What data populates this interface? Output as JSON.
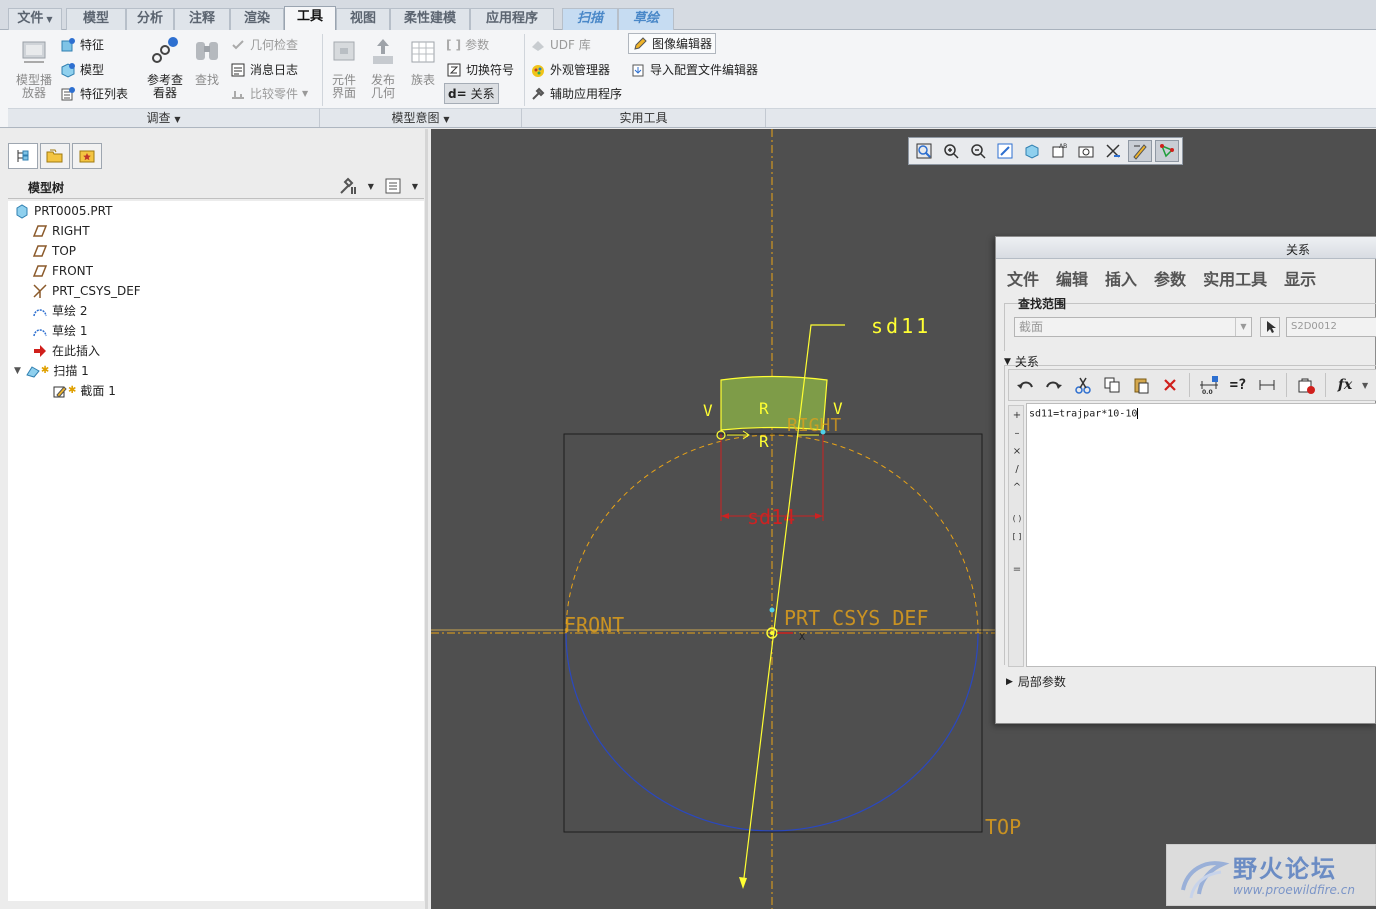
{
  "tabs": [
    {
      "label": "文件",
      "dropdown": true
    },
    {
      "label": "模型"
    },
    {
      "label": "分析"
    },
    {
      "label": "注释"
    },
    {
      "label": "渲染"
    },
    {
      "label": "工具",
      "active": true
    },
    {
      "label": "视图"
    },
    {
      "label": "柔性建模"
    },
    {
      "label": "应用程序"
    },
    {
      "label": "扫描",
      "contextual": true
    },
    {
      "label": "草绘",
      "contextual": true
    }
  ],
  "ribbon": {
    "investigate": {
      "model_player_l1": "模型播",
      "model_player_l2": "放器",
      "feature": "特征",
      "model": "模型",
      "feature_list": "特征列表",
      "ref_viewer_l1": "参考查",
      "ref_viewer_l2": "看器",
      "find": "查找",
      "geom_check": "几何检查",
      "message_log": "消息日志",
      "compare_parts": "比较零件",
      "footer": "调查"
    },
    "model_intent": {
      "component_interface_l1": "元件",
      "component_interface_l2": "界面",
      "publish_geom_l1": "发布",
      "publish_geom_l2": "几何",
      "family_table": "族表",
      "parameters": "参数",
      "switch_symbols": "切换符号",
      "relations": "关系",
      "relations_prefix": "d=",
      "footer": "模型意图"
    },
    "utilities": {
      "udf_library": "UDF 库",
      "appearance_manager": "外观管理器",
      "auxiliary_apps": "辅助应用程序",
      "image_editor": "图像编辑器",
      "import_config_editor": "导入配置文件编辑器",
      "footer": "实用工具"
    }
  },
  "model_tree": {
    "title": "模型树",
    "items": [
      {
        "label": "PRT0005.PRT",
        "icon": "part-icon"
      },
      {
        "label": "RIGHT",
        "icon": "datum-plane-icon"
      },
      {
        "label": "TOP",
        "icon": "datum-plane-icon"
      },
      {
        "label": "FRONT",
        "icon": "datum-plane-icon"
      },
      {
        "label": "PRT_CSYS_DEF",
        "icon": "csys-icon"
      },
      {
        "label": "草绘 2",
        "icon": "sketch-icon"
      },
      {
        "label": "草绘 1",
        "icon": "sketch-icon"
      },
      {
        "label": "在此插入",
        "icon": "insert-arrow-icon"
      },
      {
        "label": "扫描 1",
        "icon": "sweep-icon"
      },
      {
        "label": "截面 1",
        "icon": "section-icon"
      }
    ]
  },
  "viewport": {
    "labels": {
      "sd11": "sd11",
      "sd14": "sd14",
      "front": "FRONT",
      "top": "TOP",
      "right": "RIGHT",
      "csys": "PRT_CSYS_DEF",
      "x": "X",
      "v": "V",
      "r": "R"
    },
    "colors": {
      "background": "#4f4f4f",
      "datum": "#e8a317",
      "sketch": "#ffff33",
      "dimension": "#cc2222",
      "circle": "#2a48c0",
      "section_fill": "#7e9c48"
    }
  },
  "dialog": {
    "title": "关系",
    "menu": [
      "文件",
      "编辑",
      "插入",
      "参数",
      "实用工具",
      "显示"
    ],
    "scope_label": "查找范围",
    "scope_value": "截面",
    "symbol_field": "S2D0012",
    "relations_header": "关系",
    "relation_text": "sd11=trajpar*10-10",
    "local_params": "局部参数",
    "side_keys": [
      "+",
      "–",
      "×",
      "/",
      "^",
      "( )",
      "[ ]",
      "="
    ]
  },
  "watermark": {
    "title": "野火论坛",
    "url": "www.proewildfire.cn"
  }
}
